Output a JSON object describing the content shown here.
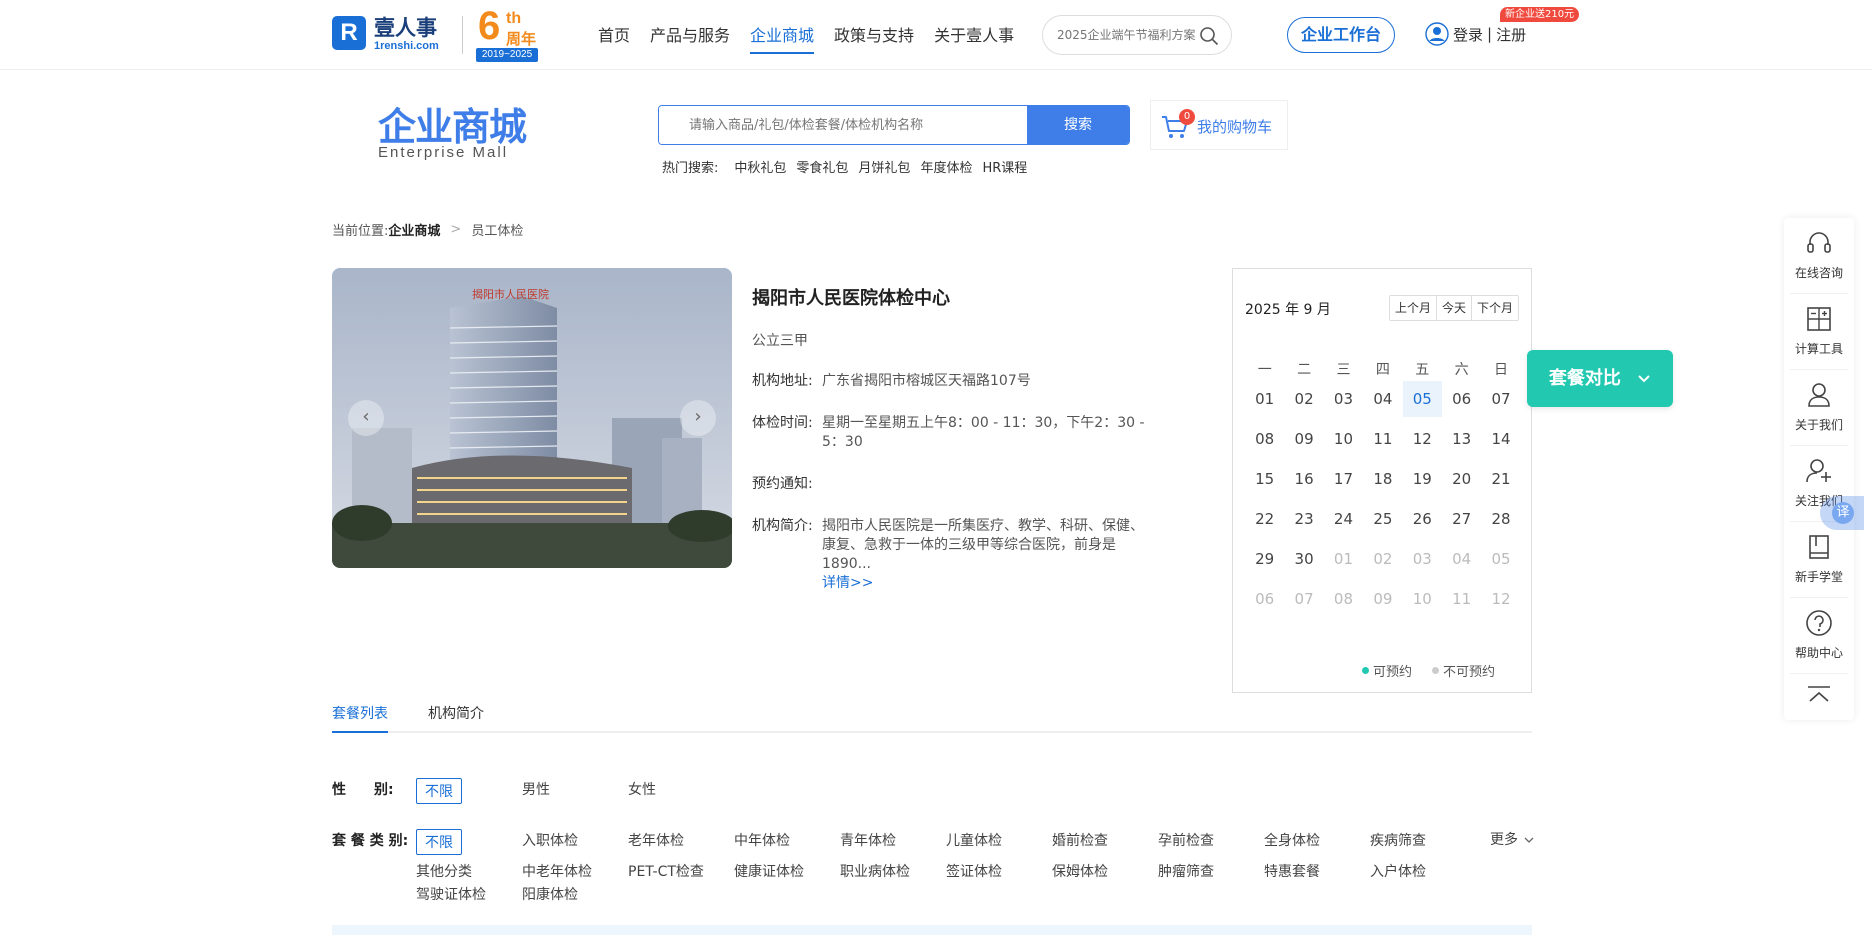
{
  "nav": {
    "logo_mark": "R",
    "logo_name": "壹人事",
    "logo_url": "1renshi.com",
    "anniv_six": "6",
    "anniv_th": "th",
    "anniv_zn": "周年",
    "anniv_years": "2019~2025",
    "links": [
      "首页",
      "产品与服务",
      "企业商城",
      "政策与支持",
      "关于壹人事"
    ],
    "active_link": "企业商城",
    "search_placeholder": "2025企业端午节福利方案",
    "workbench": "企业工作台",
    "login": "登录",
    "sep": "|",
    "register": "注册",
    "new_badge": "新企业送210元"
  },
  "mall": {
    "title": "企业商城",
    "subtitle": "Enterprise Mall",
    "search_placeholder": "请输入商品/礼包/体检套餐/体检机构名称",
    "search_button": "搜索",
    "cart_count": "0",
    "cart_label": "我的购物车",
    "hot_label": "热门搜索:",
    "hot_items": [
      "中秋礼包",
      "零食礼包",
      "月饼礼包",
      "年度体检",
      "HR课程"
    ]
  },
  "breadcrumb": {
    "prefix": "当前位置:",
    "level1": "企业商城",
    "arrow": ">",
    "level2": "员工体检"
  },
  "carousel": {
    "prev": "‹",
    "next": "›"
  },
  "hospital": {
    "name": "揭阳市人民医院体检中心",
    "grade": "公立三甲",
    "address_label": "机构地址:",
    "address": "广东省揭阳市榕城区天福路107号",
    "hours_label": "体检时间:",
    "hours": "星期一至星期五上午8：00 - 11：30，下午2：30 - 5：30",
    "notice_label": "预约通知:",
    "notice": "",
    "intro_label": "机构简介:",
    "intro": "揭阳市人民医院是一所集医疗、教学、科研、保健、康复、急救于一体的三级甲等综合医院，前身是1890...",
    "more": "详情>>"
  },
  "calendar": {
    "year_month": "2025 年 9 月",
    "prev": "上个月",
    "today": "今天",
    "next": "下个月",
    "weekdays": [
      "一",
      "二",
      "三",
      "四",
      "五",
      "六",
      "日"
    ],
    "weeks": [
      [
        "01",
        "02",
        "03",
        "04",
        "05",
        "06",
        "07"
      ],
      [
        "08",
        "09",
        "10",
        "11",
        "12",
        "13",
        "14"
      ],
      [
        "15",
        "16",
        "17",
        "18",
        "19",
        "20",
        "21"
      ],
      [
        "22",
        "23",
        "24",
        "25",
        "26",
        "27",
        "28"
      ],
      [
        "29",
        "30",
        "01",
        "02",
        "03",
        "04",
        "05"
      ],
      [
        "06",
        "07",
        "08",
        "09",
        "10",
        "11",
        "12"
      ]
    ],
    "highlighted_day": "05",
    "legend_available": "可预约",
    "legend_unavailable": "不可预约",
    "color_available": "#23c8b0",
    "color_unavailable": "#cccccc"
  },
  "compare_button": "套餐对比",
  "sidebar": {
    "items": [
      {
        "label": "在线咨询",
        "icon": "headset-icon"
      },
      {
        "label": "计算工具",
        "icon": "calculator-icon"
      },
      {
        "label": "关于我们",
        "icon": "user-icon"
      },
      {
        "label": "关注我们",
        "icon": "user-add-icon"
      },
      {
        "label": "新手学堂",
        "icon": "book-icon"
      },
      {
        "label": "帮助中心",
        "icon": "help-icon"
      }
    ],
    "translate": "译"
  },
  "tabs": [
    "套餐列表",
    "机构简介"
  ],
  "filters": {
    "gender_label": "性　　别:",
    "gender_options": [
      "不限",
      "男性",
      "女性"
    ],
    "type_label": "套 餐 类 别:",
    "type_options": [
      "不限",
      "入职体检",
      "老年体检",
      "中年体检",
      "青年体检",
      "儿童体检",
      "婚前检查",
      "孕前检查",
      "全身体检",
      "疾病筛查",
      "其他分类",
      "中老年体检",
      "PET-CT检查",
      "健康证体检",
      "职业病体检",
      "签证体检",
      "保姆体检",
      "肿瘤筛查",
      "特惠套餐",
      "入户体检",
      "驾驶证体检",
      "阳康体检"
    ],
    "more": "更多"
  },
  "colors": {
    "brand": "#1a6fd6",
    "accent": "#3f7ee8",
    "teal": "#23c8b0",
    "badge": "#f04a3e"
  }
}
